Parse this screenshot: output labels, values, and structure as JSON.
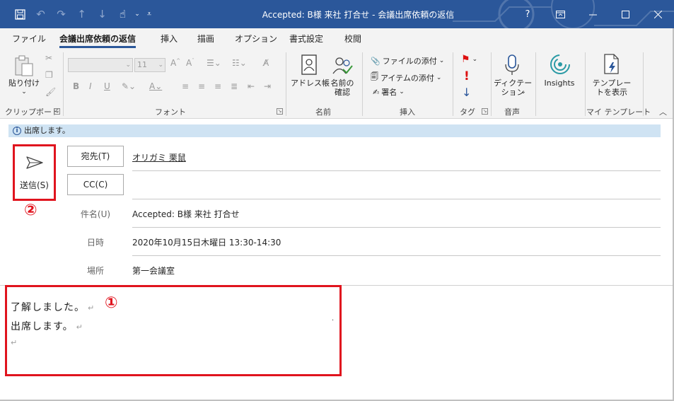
{
  "window": {
    "title": "Accepted: B様 来社 打合せ - 会議出席依頼の返信"
  },
  "quick_access": {
    "icons": [
      "save-icon",
      "undo-icon",
      "redo-icon",
      "up-arrow-icon",
      "down-arrow-icon",
      "touch-mode-icon"
    ]
  },
  "title_buttons": {
    "help": "?"
  },
  "tabs": [
    {
      "label": "ファイル"
    },
    {
      "label": "会議出席依頼の返信",
      "active": true
    },
    {
      "label": "挿入"
    },
    {
      "label": "描画"
    },
    {
      "label": "オプション"
    },
    {
      "label": "書式設定"
    },
    {
      "label": "校閲"
    }
  ],
  "ribbon": {
    "clipboard": {
      "group": "クリップボード",
      "paste": "貼り付け"
    },
    "font": {
      "group": "フォント",
      "size": "11"
    },
    "names": {
      "group": "名前",
      "address_book": "アドレス帳",
      "check_names_1": "名前の",
      "check_names_2": "確認"
    },
    "insert": {
      "group": "挿入",
      "attach_file": "ファイルの添付",
      "attach_item": "アイテムの添付",
      "signature": "署名"
    },
    "tags": {
      "group": "タグ"
    },
    "voice": {
      "group": "音声",
      "dictate_1": "ディクテー",
      "dictate_2": "ション"
    },
    "insights": {
      "label": "Insights"
    },
    "templates": {
      "group": "マイ テンプレート",
      "view_1": "テンプレー",
      "view_2": "トを表示"
    }
  },
  "info_bar": {
    "text": "出席します。"
  },
  "send": {
    "label": "送信(S)"
  },
  "annotations": {
    "one": "①",
    "two": "②"
  },
  "fields": {
    "to_button": "宛先(T)",
    "to_value": "オリガミ 栗鼠",
    "cc_button": "CC(C)",
    "subject_label": "件名(U)",
    "subject_value": "Accepted: B様 来社 打合せ",
    "datetime_label": "日時",
    "datetime_value": "2020年10月15日木曜日 13:30-14:30",
    "location_label": "場所",
    "location_value": "第一会議室"
  },
  "body": {
    "line1": "了解しました。",
    "line2": "出席します。",
    "paragraph_mark": "↵"
  },
  "colors": {
    "titlebar": "#2b579a",
    "highlight": "#e0141e",
    "infobar": "#cfe3f3"
  }
}
